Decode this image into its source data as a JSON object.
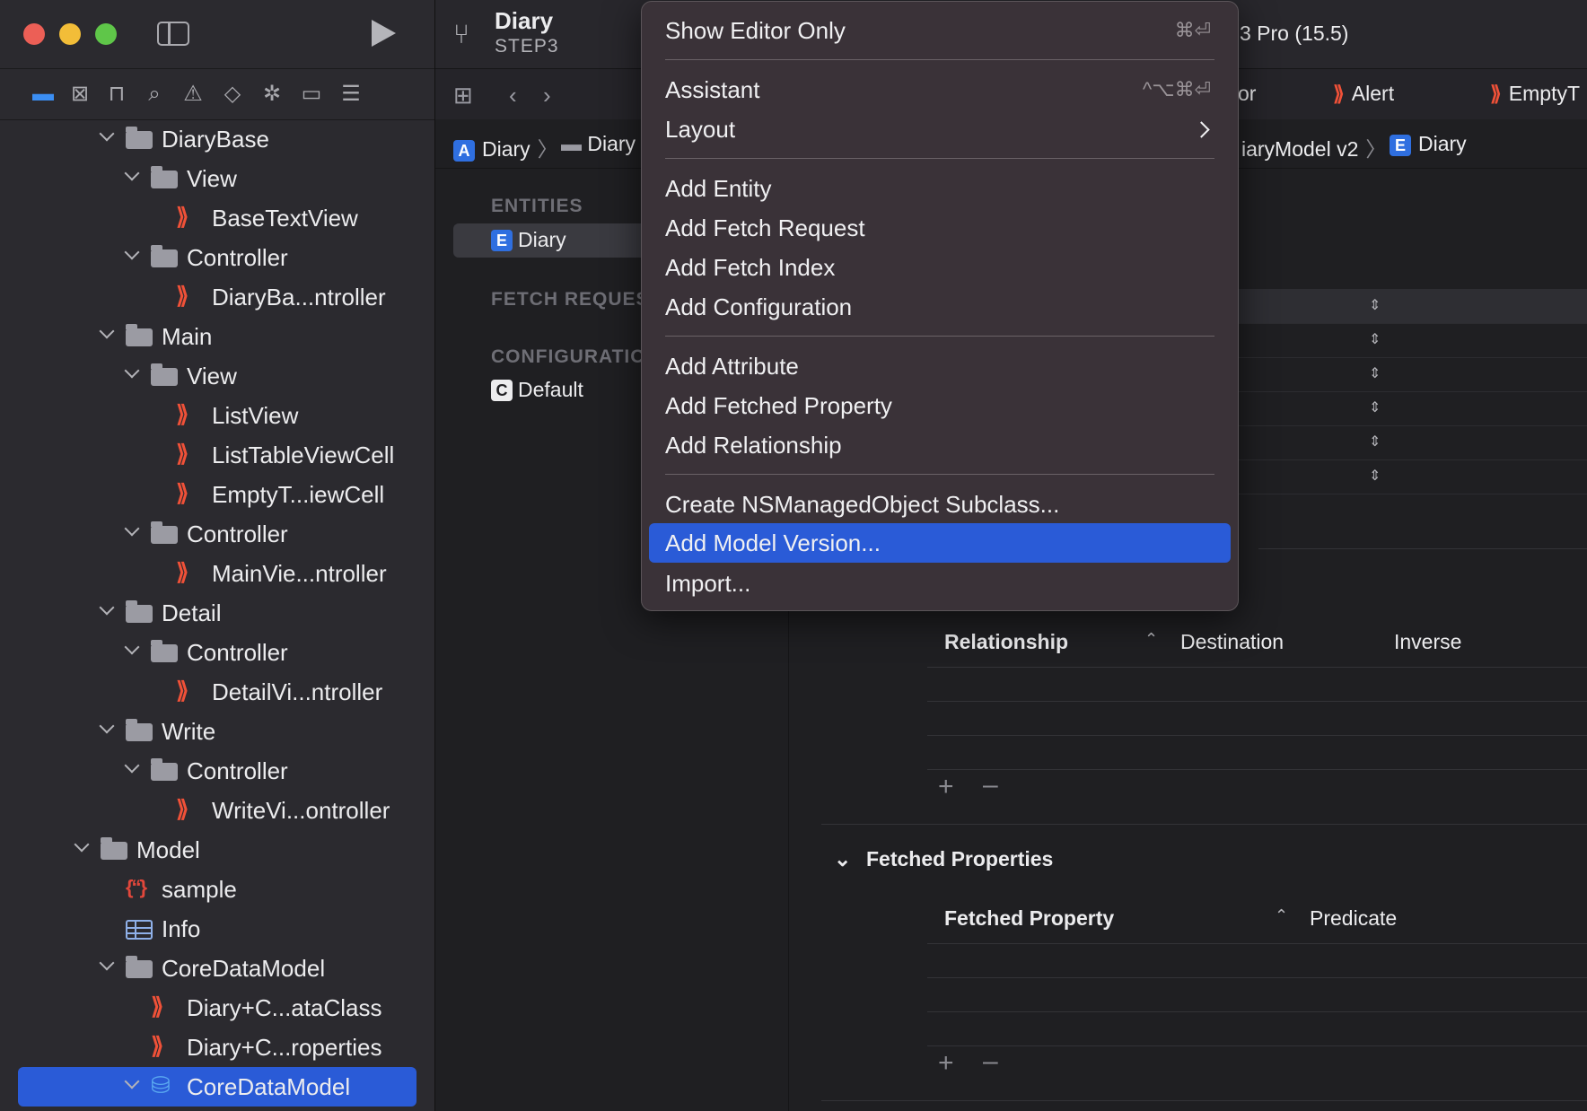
{
  "sidebar": {
    "nav_icons": [
      "folder-icon",
      "source-control-icon",
      "symbol-icon",
      "search-icon",
      "warning-icon",
      "test-icon",
      "debug-icon",
      "breakpoint-icon",
      "report-icon"
    ],
    "tree": [
      {
        "label": "DiaryBase",
        "type": "folder",
        "expanded": true
      },
      {
        "label": "View",
        "type": "folder",
        "expanded": true
      },
      {
        "label": "BaseTextView",
        "type": "swift"
      },
      {
        "label": "Controller",
        "type": "folder",
        "expanded": true
      },
      {
        "label": "DiaryBa...ntroller",
        "type": "swift"
      },
      {
        "label": "Main",
        "type": "folder",
        "expanded": true
      },
      {
        "label": "View",
        "type": "folder",
        "expanded": true
      },
      {
        "label": "ListView",
        "type": "swift"
      },
      {
        "label": "ListTableViewCell",
        "type": "swift"
      },
      {
        "label": "EmptyT...iewCell",
        "type": "swift"
      },
      {
        "label": "Controller",
        "type": "folder",
        "expanded": true
      },
      {
        "label": "MainVie...ntroller",
        "type": "swift"
      },
      {
        "label": "Detail",
        "type": "folder",
        "expanded": true
      },
      {
        "label": "Controller",
        "type": "folder",
        "expanded": true
      },
      {
        "label": "DetailVi...ntroller",
        "type": "swift"
      },
      {
        "label": "Write",
        "type": "folder",
        "expanded": true
      },
      {
        "label": "Controller",
        "type": "folder",
        "expanded": true
      },
      {
        "label": "WriteVi...ontroller",
        "type": "swift"
      },
      {
        "label": "Model",
        "type": "folder",
        "expanded": true
      },
      {
        "label": "sample",
        "type": "json"
      },
      {
        "label": "Info",
        "type": "plist"
      },
      {
        "label": "CoreDataModel",
        "type": "folder",
        "expanded": true
      },
      {
        "label": "Diary+C...ataClass",
        "type": "swift"
      },
      {
        "label": "Diary+C...roperties",
        "type": "swift"
      },
      {
        "label": "CoreDataModel",
        "type": "coredata",
        "expanded": true,
        "selected": true
      }
    ]
  },
  "toolbar": {
    "scheme_title": "Diary",
    "scheme_subtitle": "STEP3",
    "device": "3 Pro (15.5)",
    "tabs": [
      "or",
      "Alert",
      "EmptyT"
    ]
  },
  "jumpbar": {
    "left": [
      "Diary",
      "Diary"
    ],
    "right": [
      "iaryModel v2",
      "Diary"
    ]
  },
  "outline": {
    "entities_header": "ENTITIES",
    "entity": "Diary",
    "fetch_header": "FETCH REQUES",
    "config_header": "CONFIGURATIO",
    "config": "Default"
  },
  "relationships": {
    "columns": [
      "Relationship",
      "Destination",
      "Inverse"
    ]
  },
  "fetched": {
    "title": "Fetched Properties",
    "columns": [
      "Fetched Property",
      "Predicate"
    ]
  },
  "menu": {
    "items": [
      {
        "label": "Show Editor Only",
        "shortcut": "⌘⏎"
      },
      {
        "label": "Assistant",
        "shortcut": "^⌥⌘⏎"
      },
      {
        "label": "Layout",
        "submenu": true
      },
      {
        "label": "Add Entity"
      },
      {
        "label": "Add Fetch Request"
      },
      {
        "label": "Add Fetch Index"
      },
      {
        "label": "Add Configuration"
      },
      {
        "label": "Add Attribute"
      },
      {
        "label": "Add Fetched Property"
      },
      {
        "label": "Add Relationship"
      },
      {
        "label": "Create NSManagedObject Subclass..."
      },
      {
        "label": "Add Model Version...",
        "highlighted": true
      },
      {
        "label": "Import..."
      }
    ]
  },
  "colors": {
    "accent": "#2a5bd7",
    "swift": "#f05138",
    "close": "#ec5f56",
    "minimize": "#f2bd38",
    "zoom": "#5fc649"
  }
}
